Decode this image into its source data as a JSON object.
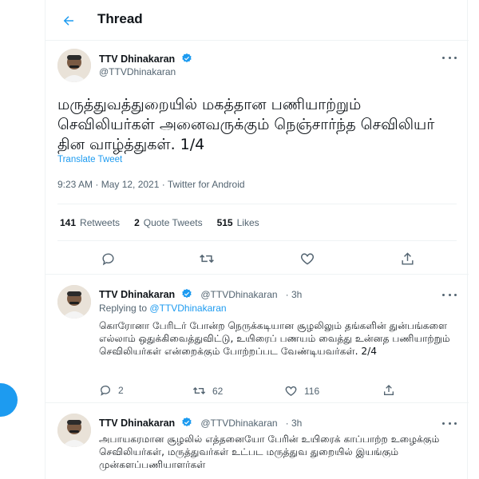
{
  "header": {
    "title": "Thread"
  },
  "main_tweet": {
    "name": "TTV Dhinakaran",
    "handle": "@TTVDhinakaran",
    "text": "மருத்துவத்துறையில் மகத்தான பணியாற்றும் செவிலியர்கள் அனைவருக்கும் நெஞ்சார்ந்த செவிலியர் தின வாழ்த்துகள். 1/4",
    "translate_label": "Translate Tweet",
    "meta": "9:23 AM · May 12, 2021 · Twitter for Android",
    "stats": {
      "retweets_count": "141",
      "retweets_label": "Retweets",
      "quotes_count": "2",
      "quotes_label": "Quote Tweets",
      "likes_count": "515",
      "likes_label": "Likes"
    }
  },
  "replies": [
    {
      "name": "TTV Dhinakaran",
      "handle": "@TTVDhinakaran",
      "time": "· 3h",
      "replying_prefix": "Replying to",
      "replying_to": "@TTVDhinakaran",
      "text": "கொரோனா பேரிடர் போன்ற நெருக்கடியான சூழலிலும் தங்களின் துன்பங்களை எல்லாம் ஒதுக்கிவைத்துவிட்டு, உயிரைப் பணயம் வைத்து உன்னத பணியாற்றும் செவிலியர்கள் என்றைக்கும் போற்றப்பட வேண்டியவர்கள். 2/4",
      "reply_count": "2",
      "retweet_count": "62",
      "like_count": "116"
    },
    {
      "name": "TTV Dhinakaran",
      "handle": "@TTVDhinakaran",
      "time": "· 3h",
      "text": "அபாயகரமான சூழலில் எத்தனையோ பேரின் உயிரைக் காப்பாற்ற உழைக்கும் செவிலியர்கள், மருத்துவர்கள் உட்பட மருத்துவ துறையில் இயங்கும் முன்களப்பணியாளர்கள்"
    }
  ],
  "colors": {
    "accent": "#1d9bf0",
    "text": "#0f1419",
    "secondary": "#536471",
    "border": "#eff3f4"
  },
  "icons": [
    "back-arrow-icon",
    "verified-badge-icon",
    "more-icon",
    "reply-icon",
    "retweet-icon",
    "like-icon",
    "share-icon"
  ]
}
